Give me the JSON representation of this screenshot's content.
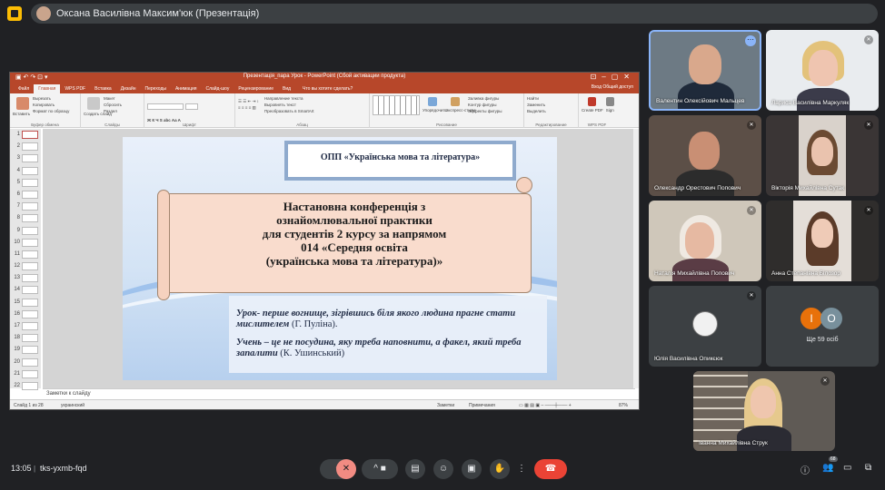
{
  "top": {
    "presenter_label": "Оксана Василівна Максим'юк (Презентація)"
  },
  "ppt": {
    "window_title": "Презентація_пара Урок - PowerPoint (Сбой активации продукта)",
    "tabs": [
      "Файл",
      "Главная",
      "WPS PDF",
      "Вставка",
      "Дизайн",
      "Переходы",
      "Анимация",
      "Слайд-шоу",
      "Рецензирование",
      "Вид"
    ],
    "tell_me": "Что вы хотите сделать?",
    "right_items": "Вход   Общий доступ",
    "ribbon": {
      "insert": "Вставить",
      "cut": "Вырезать",
      "copy": "Копировать",
      "format_painter": "Формат по образцу",
      "clipboard": "Буфер обмена",
      "layout": "Макет",
      "reset": "Сбросить",
      "section": "Раздел",
      "new_slide": "Создать слайд",
      "slides": "Слайды",
      "font": "Шрифт",
      "paragraph": "Абзац",
      "text_dir": "Направление текста",
      "align_text": "Выровнять текст",
      "smartart": "Преобразовать в SmartArt",
      "arrange": "Упорядочить",
      "quick_styles": "Экспресс-стили",
      "fill": "Заливка фигуры",
      "outline": "Контур фигуры",
      "effects": "Эффекты фигуры",
      "drawing": "Рисование",
      "find": "Найти",
      "replace": "Заменить",
      "select": "Выделить",
      "editing": "Редактирование",
      "create_pdf": "Create PDF",
      "sign": "Sign",
      "wps_pdf": "WPS PDF"
    },
    "thumbnail_numbers": [
      "1",
      "2",
      "3",
      "4",
      "5",
      "6",
      "7",
      "8",
      "9",
      "10",
      "11",
      "12",
      "13",
      "14",
      "15",
      "16",
      "17",
      "18",
      "19",
      "20",
      "21",
      "22"
    ],
    "notes_placeholder": "Заметки к слайду",
    "status_left": "Слайд 1 из 28",
    "status_lang": "украинский",
    "status_notes": "Заметки",
    "status_comments": "Примечания",
    "zoom": "87%"
  },
  "slide": {
    "header": "ОПП «Українська мова та література»",
    "conference_lines": [
      "Настановна конференція з",
      "ознайомлювальної практики",
      "для студентів 2 курсу за напрямом",
      "014 «Середня освіта",
      "(українська мова та література)»"
    ],
    "quote1_text": "Урок- перше вогнище, зігрівшись біля якого   людина прагне стати мислителем",
    "quote1_author": "(Г. Пуліна).",
    "quote2_text": "Учень – це не посудина, яку треба наповнити, а факел, який треба запалити",
    "quote2_author": "(К. Ушинський)"
  },
  "participants": [
    {
      "name": "Валентин Олексійович Мальцев"
    },
    {
      "name": "Лариса Василівна Маркуляк"
    },
    {
      "name": "Олександр Орестович Попович"
    },
    {
      "name": "Вікторія Михайлівна Сутак"
    },
    {
      "name": "Наталія Михайлівна Попович"
    },
    {
      "name": "Анна Степанівна Білозор"
    },
    {
      "name": "Юлія Василівна Опикєюк"
    },
    {
      "name": "Іванна Михайлівна Струк"
    }
  ],
  "others": {
    "label": "Ще 59 осіб",
    "initials": [
      "І",
      "О"
    ]
  },
  "bottom": {
    "time": "13:05",
    "separator": "|",
    "meeting_code": "tks-yxmb-fqd",
    "participants_badge": "68"
  },
  "colors": {
    "ppt_accent": "#b7472a",
    "end_call": "#ea4335",
    "mic_off": "#f28b82",
    "avatar_orange": "#e8710a",
    "avatar_slate": "#78909c"
  }
}
